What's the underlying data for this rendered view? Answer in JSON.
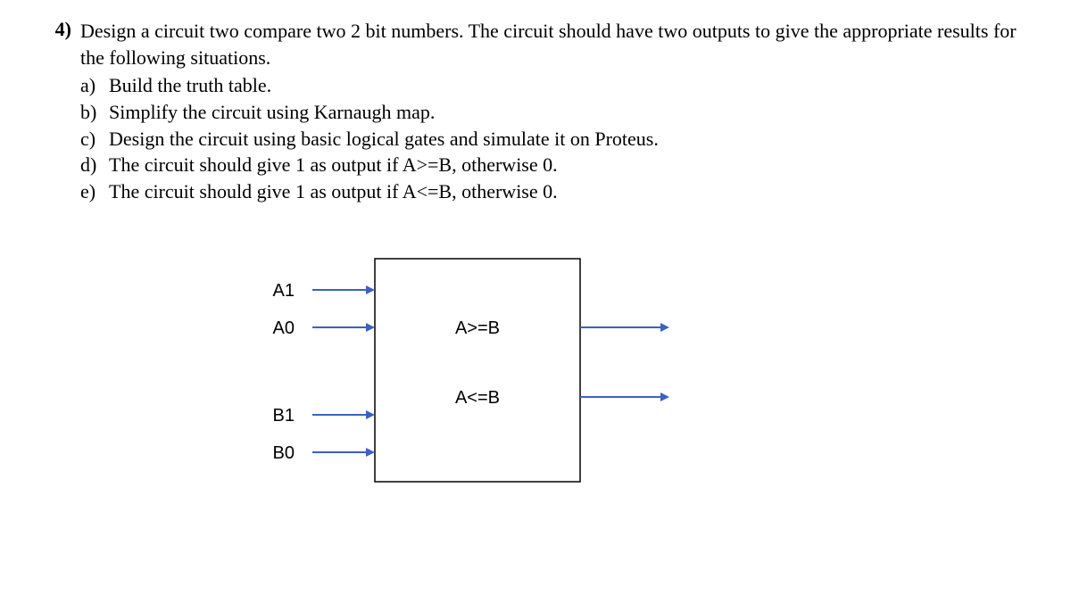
{
  "question": {
    "number": "4)",
    "prompt": "Design a circuit two compare two 2 bit numbers. The circuit should have two outputs to give the appropriate results for the following situations.",
    "subs": [
      {
        "label": "a)",
        "text": "Build the truth table."
      },
      {
        "label": "b)",
        "text": "Simplify the circuit using Karnaugh map."
      },
      {
        "label": "c)",
        "text": "Design the circuit using basic logical gates and simulate it on Proteus."
      },
      {
        "label": "d)",
        "text": " The circuit should give 1 as output if A>=B, otherwise 0."
      },
      {
        "label": "e)",
        "text": "The circuit should give 1 as output if A<=B, otherwise 0."
      }
    ]
  },
  "diagram": {
    "inputs": [
      "A1",
      "A0",
      "B1",
      "B0"
    ],
    "outputs": [
      "A>=B",
      "A<=B"
    ]
  }
}
